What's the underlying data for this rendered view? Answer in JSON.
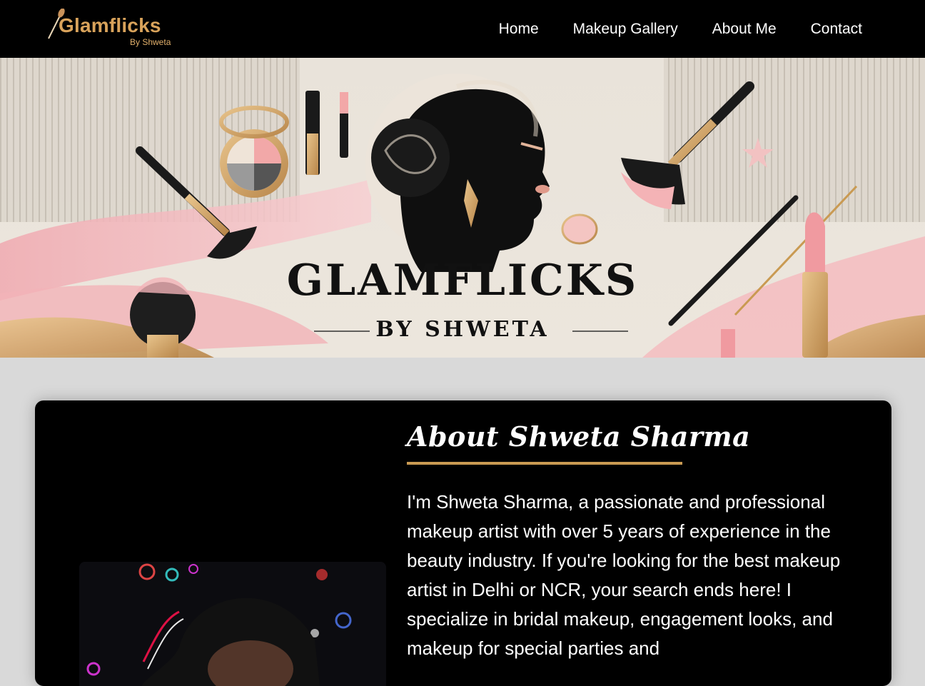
{
  "brand": {
    "name": "Glamflicks",
    "tagline": "By Shweta",
    "accent": "#d9a35b"
  },
  "nav": {
    "items": [
      {
        "label": "Home"
      },
      {
        "label": "Makeup Gallery"
      },
      {
        "label": "About Me"
      },
      {
        "label": "Contact"
      }
    ]
  },
  "banner": {
    "title": "GLAMFLICKS",
    "subtitle": "BY SHWETA"
  },
  "about": {
    "heading": "About Shweta Sharma",
    "body": "I'm Shweta Sharma, a passionate and professional makeup artist with over 5 years of experience in the beauty industry. If you're looking for the best makeup artist in Delhi or NCR, your search ends here! I specialize in bridal makeup, engagement looks, and makeup for special parties and"
  },
  "colors": {
    "header_bg": "#000000",
    "page_bg": "#d9d9d9",
    "rule": "#c99a52",
    "pink": "#f2b3b8"
  }
}
